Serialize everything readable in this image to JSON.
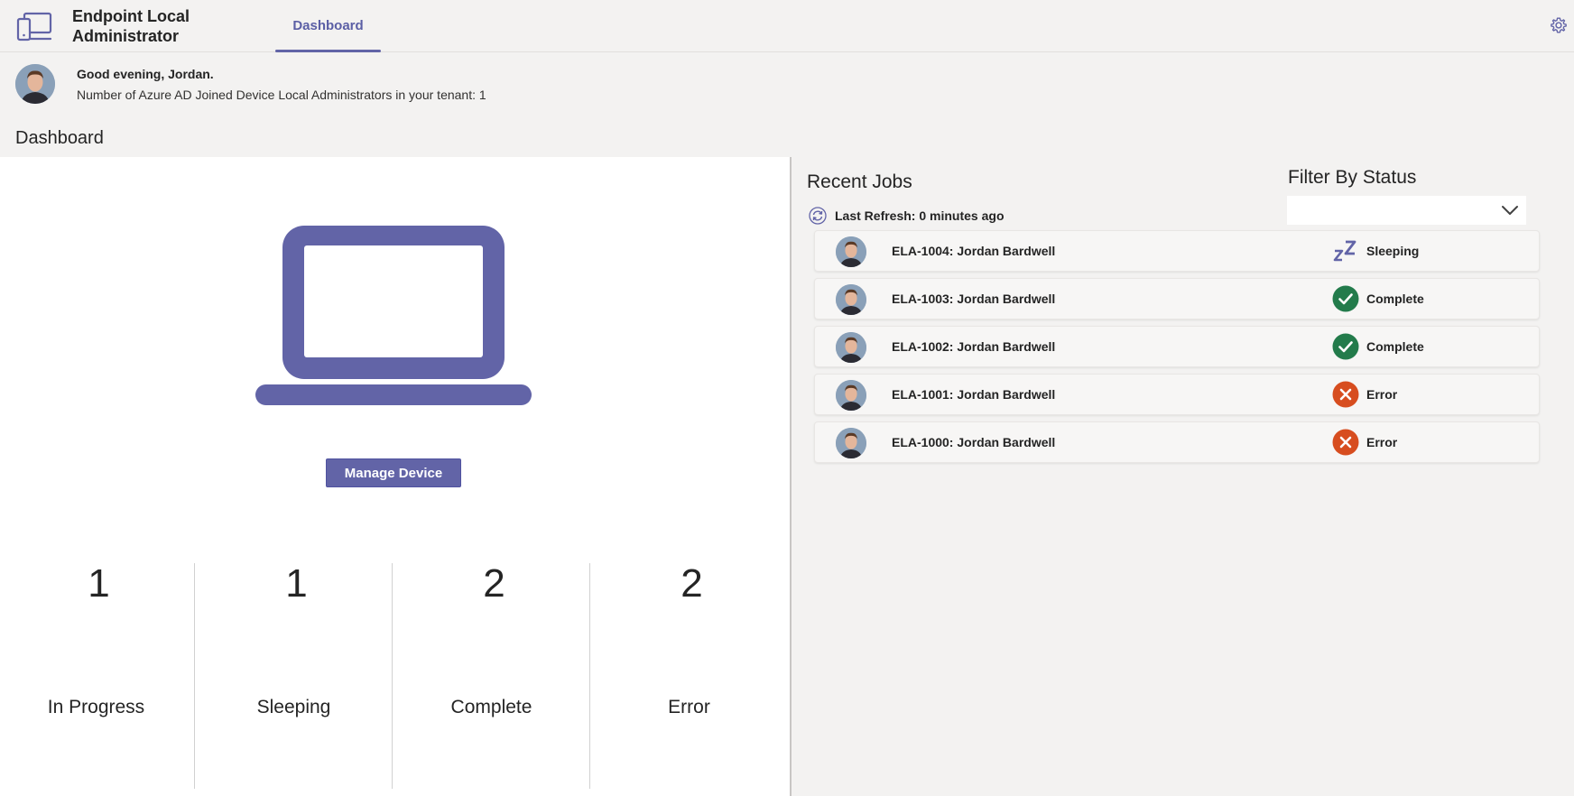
{
  "app": {
    "title": "Endpoint Local Administrator"
  },
  "nav": {
    "tabs": [
      {
        "label": "Dashboard"
      }
    ]
  },
  "greeting": {
    "line1": "Good evening, Jordan.",
    "line2": "Number of Azure AD Joined Device Local Administrators in your tenant: 1"
  },
  "dashboard": {
    "title": "Dashboard",
    "manage_button": "Manage Device",
    "stats": [
      {
        "value": "1",
        "label": "In Progress"
      },
      {
        "value": "1",
        "label": "Sleeping"
      },
      {
        "value": "2",
        "label": "Complete"
      },
      {
        "value": "2",
        "label": "Error"
      }
    ]
  },
  "recent_jobs": {
    "title": "Recent Jobs",
    "last_refresh": "Last Refresh: 0 minutes ago",
    "filter_title": "Filter By Status",
    "filter_value": "",
    "jobs": [
      {
        "title": "ELA-1004: Jordan Bardwell",
        "status": "Sleeping",
        "icon": "sleeping-icon"
      },
      {
        "title": "ELA-1003: Jordan Bardwell",
        "status": "Complete",
        "icon": "check-icon"
      },
      {
        "title": "ELA-1002: Jordan Bardwell",
        "status": "Complete",
        "icon": "check-icon"
      },
      {
        "title": "ELA-1001: Jordan Bardwell",
        "status": "Error",
        "icon": "error-icon"
      },
      {
        "title": "ELA-1000: Jordan Bardwell",
        "status": "Error",
        "icon": "error-icon"
      }
    ]
  },
  "colors": {
    "accent": "#6264a7",
    "complete": "#237b4b",
    "error": "#d74d1f",
    "background": "#f3f2f1"
  }
}
